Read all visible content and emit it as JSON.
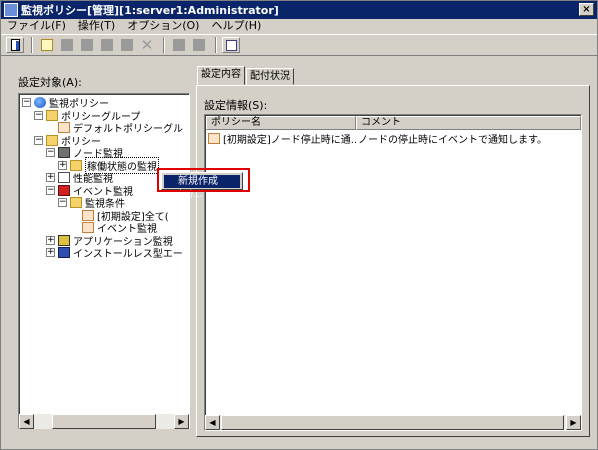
{
  "window": {
    "title": "監視ポリシー[管理][1:server1:Administrator]",
    "close_label": "×"
  },
  "menubar": [
    "ファイル(F)",
    "操作(T)",
    "オプション(O)",
    "ヘルプ(H)"
  ],
  "toolbar": {
    "buttons": [
      {
        "icon": "open-console-icon",
        "enabled": true
      },
      {
        "icon": "new-icon",
        "enabled": true
      },
      {
        "icon": "copy-icon",
        "enabled": false
      },
      {
        "icon": "edit-icon",
        "enabled": false
      },
      {
        "icon": "paste-icon",
        "enabled": false
      },
      {
        "icon": "duplicate-icon",
        "enabled": false
      },
      {
        "icon": "delete-icon",
        "enabled": false
      },
      {
        "icon": "import-icon",
        "enabled": false
      },
      {
        "icon": "export-icon",
        "enabled": false
      },
      {
        "icon": "filter-icon",
        "enabled": true
      }
    ],
    "delete_glyph": "✕"
  },
  "left": {
    "label": "設定対象(A):",
    "tree": [
      {
        "label": "監視ポリシー",
        "icon": "globe",
        "level": 0,
        "expander": "⊟"
      },
      {
        "label": "ポリシーグループ",
        "icon": "folder",
        "level": 1,
        "expander": "⊟"
      },
      {
        "label": "デフォルトポリシーグル",
        "icon": "doc",
        "level": 2,
        "expander": ""
      },
      {
        "label": "ポリシー",
        "icon": "folder",
        "level": 1,
        "expander": "⊟"
      },
      {
        "label": "ノード監視",
        "icon": "node",
        "level": 2,
        "expander": "⊟"
      },
      {
        "label": "稼働状態の監視",
        "icon": "folder",
        "level": 3,
        "expander": "⊞"
      },
      {
        "label": "性能監視",
        "icon": "chart",
        "level": 2,
        "expander": "⊞"
      },
      {
        "label": "イベント監視",
        "icon": "event",
        "level": 2,
        "expander": "⊟"
      },
      {
        "label": "監視条件",
        "icon": "folder",
        "level": 3,
        "expander": "⊟"
      },
      {
        "label": "[初期設定]全て(",
        "icon": "doc",
        "level": 4,
        "expander": ""
      },
      {
        "label": "イベント監視",
        "icon": "doc",
        "level": 4,
        "expander": ""
      },
      {
        "label": "アプリケーション監視",
        "icon": "app",
        "level": 2,
        "expander": "⊞"
      },
      {
        "label": "インストールレス型エー",
        "icon": "install",
        "level": 2,
        "expander": "⊞"
      }
    ]
  },
  "context_menu": {
    "item": "新規作成(N)..."
  },
  "right": {
    "tabs": [
      "設定内容",
      "配付状況"
    ],
    "active_tab": 0,
    "info_label": "設定情報(S):",
    "columns": [
      "ポリシー名",
      "コメント"
    ],
    "rows": [
      {
        "name": "[初期設定]ノード停止時に通...",
        "comment": "ノードの停止時にイベントで通知します。"
      }
    ]
  },
  "scroll": {
    "left": "◀",
    "right": "▶"
  }
}
